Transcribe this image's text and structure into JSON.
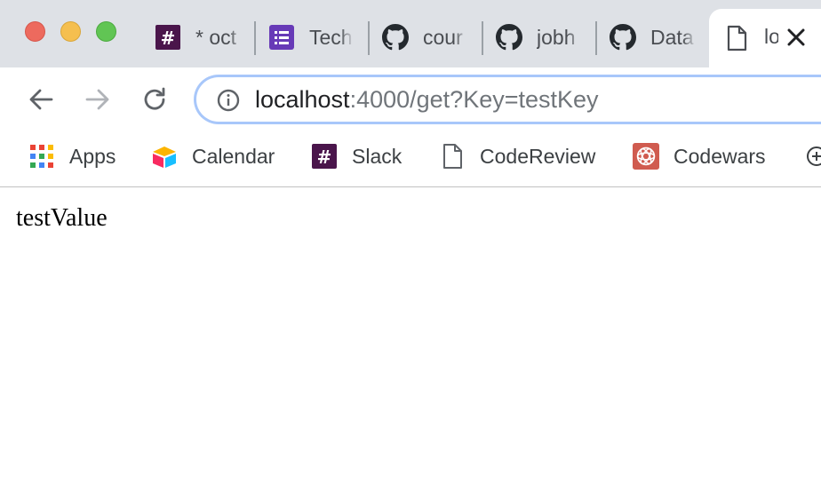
{
  "window": {
    "traffic_lights": [
      "close",
      "minimize",
      "maximize"
    ]
  },
  "tabs": [
    {
      "label": "* oct",
      "icon": "slack-hash-icon",
      "color": "#4a154b"
    },
    {
      "label": "Tech",
      "icon": "list-form-icon",
      "color": "#673ab7"
    },
    {
      "label": "cour",
      "icon": "github-icon",
      "color": "#24292e"
    },
    {
      "label": "jobh",
      "icon": "github-icon",
      "color": "#24292e"
    },
    {
      "label": "Data",
      "icon": "github-icon",
      "color": "#24292e"
    }
  ],
  "active_tab": {
    "label": "lo",
    "icon": "page-icon",
    "close_glyph": "✕"
  },
  "toolbar": {
    "back": "back-arrow-icon",
    "forward": "forward-arrow-icon",
    "reload": "reload-icon",
    "url_host": "localhost",
    "url_rest": ":4000/get?Key=testKey"
  },
  "bookmarks": [
    {
      "label": "Apps",
      "icon": "apps-grid-icon"
    },
    {
      "label": "Calendar",
      "icon": "calendar-icon"
    },
    {
      "label": "Slack",
      "icon": "slack-hash-icon"
    },
    {
      "label": "CodeReview",
      "icon": "page-icon"
    },
    {
      "label": "Codewars",
      "icon": "codewars-icon"
    }
  ],
  "page": {
    "body_text": "testValue"
  },
  "colors": {
    "tabstrip_bg": "#dee1e6",
    "omnibox_focus": "#a8c7fa",
    "slack": "#4a154b",
    "codewars": "#d05b4f"
  }
}
